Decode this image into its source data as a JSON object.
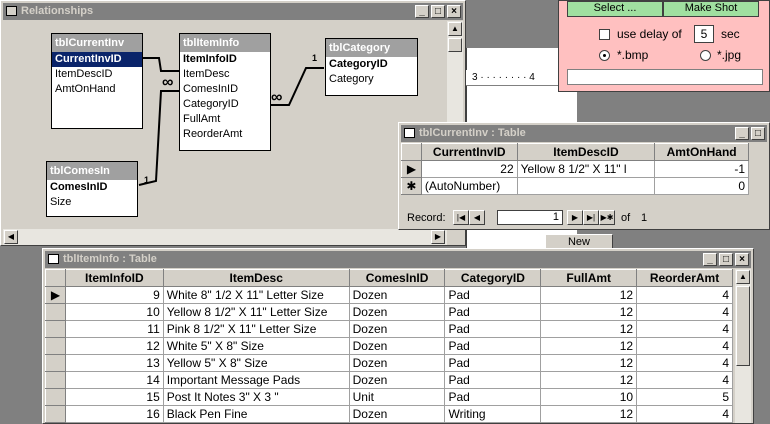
{
  "relationships": {
    "title": "Relationships",
    "tables": {
      "current_inv": {
        "name": "tblCurrentInv",
        "fields": [
          "CurrentInvID",
          "ItemDescID",
          "AmtOnHand"
        ]
      },
      "item_info": {
        "name": "tblItemInfo",
        "fields": [
          "ItemInfoID",
          "ItemDesc",
          "ComesInID",
          "CategoryID",
          "FullAmt",
          "ReorderAmt"
        ]
      },
      "category": {
        "name": "tblCategory",
        "fields": [
          "CategoryID",
          "Category"
        ]
      },
      "comes_in": {
        "name": "tblComesIn",
        "fields": [
          "ComesInID",
          "Size"
        ]
      }
    },
    "one_label": "1",
    "many_label": "∞"
  },
  "snap_tool": {
    "select_label": "Select ...",
    "make_shot_label": "Make Shot",
    "delay_label": "use delay of",
    "delay_value": "5",
    "delay_unit": "sec",
    "bmp_label": "*.bmp",
    "jpg_label": "*.jpg",
    "bg_color": "#ffc0c0"
  },
  "current_inv_table": {
    "title": "tblCurrentInv : Table",
    "columns": [
      "CurrentInvID",
      "ItemDescID",
      "AmtOnHand"
    ],
    "rows": [
      [
        "22",
        "Yellow 8 1/2\" X 11\" l",
        "-1"
      ]
    ],
    "new_row": [
      "(AutoNumber)",
      "",
      "0"
    ],
    "record_label": "Record:",
    "record_value": "1",
    "of_label": "of",
    "total": "1"
  },
  "item_info_table": {
    "title": "tblItemInfo : Table",
    "columns": [
      "ItemInfoID",
      "ItemDesc",
      "ComesInID",
      "CategoryID",
      "FullAmt",
      "ReorderAmt"
    ],
    "rows": [
      [
        "9",
        "White 8\" 1/2 X 11\" Letter Size",
        "Dozen",
        "Pad",
        "12",
        "4"
      ],
      [
        "10",
        "Yellow 8 1/2\" X 11\" Letter Size",
        "Dozen",
        "Pad",
        "12",
        "4"
      ],
      [
        "11",
        "Pink 8 1/2\" X 11\" Letter Size",
        "Dozen",
        "Pad",
        "12",
        "4"
      ],
      [
        "12",
        "White 5\" X 8\" Size",
        "Dozen",
        "Pad",
        "12",
        "4"
      ],
      [
        "13",
        "Yellow 5\" X 8\" Size",
        "Dozen",
        "Pad",
        "12",
        "4"
      ],
      [
        "14",
        "Important Message Pads",
        "Dozen",
        "Pad",
        "12",
        "4"
      ],
      [
        "15",
        "Post It Notes 3\" X 3 \"",
        "Unit",
        "Pad",
        "10",
        "5"
      ],
      [
        "16",
        "Black Pen Fine",
        "Dozen",
        "Writing",
        "12",
        "4"
      ]
    ]
  },
  "background": {
    "ruler_text": "3 · · · · · · · · 4",
    "new_button": "New"
  }
}
